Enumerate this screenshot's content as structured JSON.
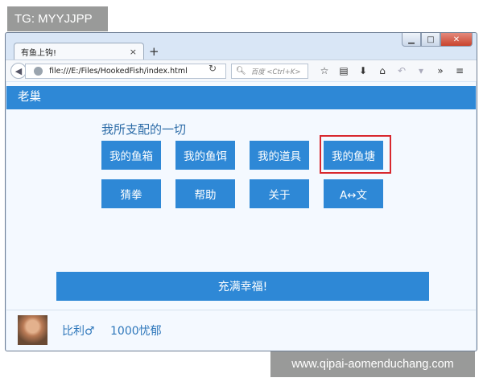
{
  "watermark": {
    "top": "TG: MYYJJPP",
    "bottom": "www.qipai-aomenduchang.com"
  },
  "browser": {
    "tab_title": "有鱼上钩!",
    "tab_close": "×",
    "new_tab": "+",
    "url": "file:///E:/Files/HookedFish/index.html",
    "search_placeholder": "百度 <Ctrl+K>",
    "window_buttons": {
      "minimize": "▁",
      "maximize": "□",
      "close": "✕"
    }
  },
  "app": {
    "header_title": "老巢",
    "section_heading": "我所支配的一切",
    "buttons_row1": [
      "我的鱼箱",
      "我的鱼饵",
      "我的道具",
      "我的鱼塘"
    ],
    "buttons_row2": [
      "猜拳",
      "帮助",
      "关于",
      "A↔文"
    ],
    "main_button": "充满幸福!"
  },
  "user": {
    "name": "比利♂",
    "mood": "1000忧郁"
  },
  "colors": {
    "accent": "#2e88d6",
    "highlight_border": "#d8282e",
    "page_bg": "#f4f9ff"
  }
}
